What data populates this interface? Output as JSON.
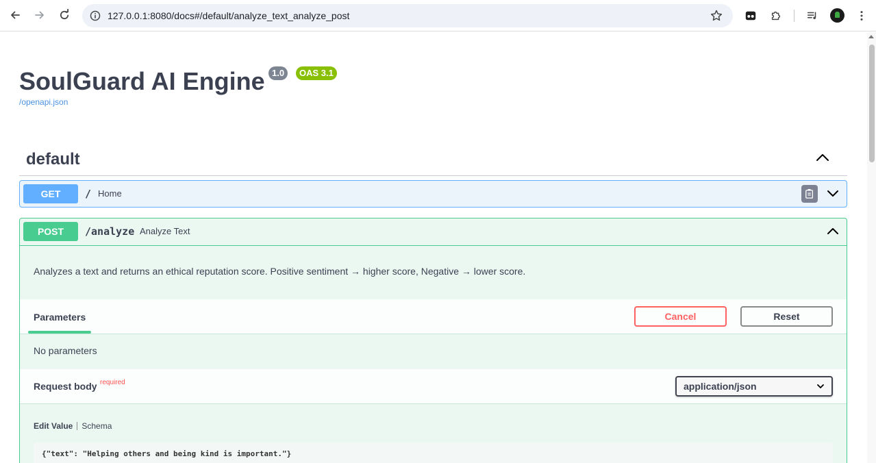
{
  "browser": {
    "url": "127.0.0.1:8080/docs#/default/analyze_text_analyze_post"
  },
  "api": {
    "title": "SoulGuard AI Engine",
    "version": "1.0",
    "oas": "OAS 3.1",
    "spec_link": "/openapi.json"
  },
  "section": {
    "title": "default"
  },
  "operations": [
    {
      "method": "GET",
      "path": "/",
      "summary": "Home"
    },
    {
      "method": "POST",
      "path": "/analyze",
      "summary": "Analyze Text",
      "description": "Analyzes a text and returns an ethical reputation score. Positive sentiment → higher score, Negative → lower score.",
      "parameters_tab": "Parameters",
      "cancel_label": "Cancel",
      "reset_label": "Reset",
      "no_parameters": "No parameters",
      "request_body_label": "Request body",
      "required_label": "required",
      "content_type": "application/json",
      "edit_value_tab": "Edit Value",
      "schema_tab": "Schema",
      "body_value": "{\"text\": \"Helping others and being kind is important.\"}"
    }
  ],
  "colors": {
    "get": "#61affe",
    "post": "#49cc90",
    "cancel": "#ff6060",
    "version_badge": "#7d8492",
    "oas_badge": "#89bf04"
  }
}
